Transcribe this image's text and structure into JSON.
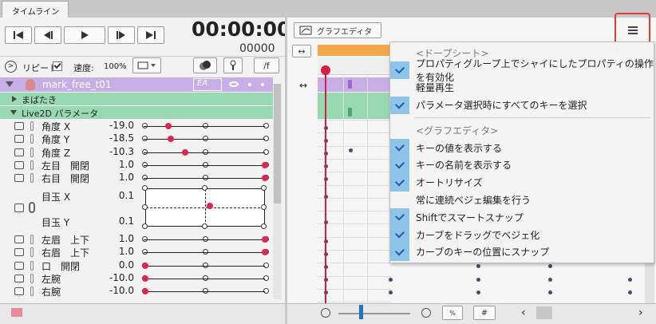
{
  "tab": {
    "label": "タイムライン"
  },
  "time": {
    "display": "00:00:00",
    "frames": "00000"
  },
  "controls": {
    "repeat_label": "リピート",
    "speed_label": "速度:",
    "speed_value": "100%",
    "frame_btn": "/f"
  },
  "model": {
    "name": "mark_free_t01",
    "badge": "EA"
  },
  "groups": {
    "blink": "まばたき",
    "params": "Live2D パラメータ"
  },
  "params": [
    {
      "label": "角度 X",
      "value": "-19.0",
      "knob": 0.19
    },
    {
      "label": "角度 Y",
      "value": "-18.5",
      "knob": 0.21
    },
    {
      "label": "角度 Z",
      "value": "-10.3",
      "knob": 0.33
    },
    {
      "label": "左目　開閉",
      "value": "1.0",
      "knob": 1.0
    },
    {
      "label": "右目　開閉",
      "value": "1.0",
      "knob": 1.0
    }
  ],
  "eyeball": {
    "x_label": "目玉 X",
    "x_value": "0.1",
    "y_label": "目玉 Y",
    "y_value": "0.1"
  },
  "params2": [
    {
      "label": "左眉　上下",
      "value": "1.0",
      "knob": 1.0
    },
    {
      "label": "右眉　上下",
      "value": "1.0",
      "knob": 1.0
    },
    {
      "label": "口　開閉",
      "value": "0.0",
      "knob": 0.0
    },
    {
      "label": "左腕",
      "value": "-10.0",
      "knob": 0.0
    },
    {
      "label": "右腕",
      "value": "-10.0",
      "knob": 0.0
    }
  ],
  "graph_editor": {
    "button": "グラフエディタ"
  },
  "menu": {
    "section1": "<ドープシート>",
    "items1": [
      {
        "label": "プロパティグループ上でシャイにしたプロパティの操作を有効化",
        "checked": true
      },
      {
        "label": "軽量再生",
        "checked": false
      },
      {
        "label": "パラメータ選択時にすべてのキーを選択",
        "checked": true
      }
    ],
    "section2": "<グラフエディタ>",
    "items2": [
      {
        "label": "キーの値を表示する",
        "checked": true
      },
      {
        "label": "キーの名前を表示する",
        "checked": true
      },
      {
        "label": "オートリサイズ",
        "checked": true
      },
      {
        "label": "常に連続ベジェ編集を行う",
        "checked": false
      },
      {
        "label": "Shiftでスマートスナップ",
        "checked": true
      },
      {
        "label": "カーブをドラッグでベジェ化",
        "checked": true
      },
      {
        "label": "カーブのキーの位置にスナップ",
        "checked": true
      }
    ]
  },
  "colors": {
    "model_row": "#c7aee6",
    "group_row": "#98d8b2",
    "playhead": "#d42040",
    "accent_orange": "#f3a64a",
    "menu_check": "#8fc4ea",
    "menu_highlight": "#e53935"
  }
}
